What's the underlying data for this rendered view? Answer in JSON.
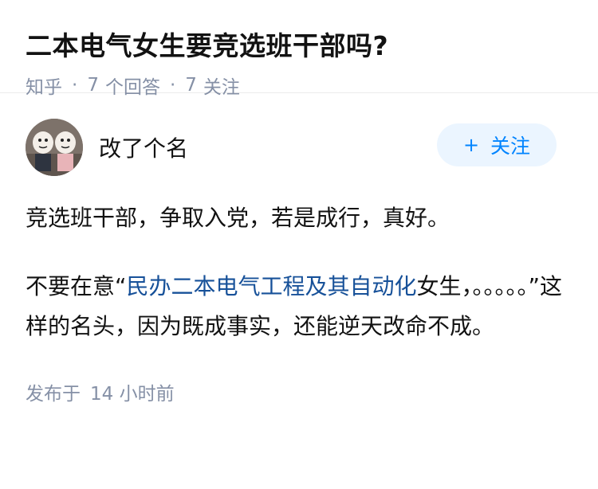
{
  "question": {
    "title": "二本电气女生要竞选班干部吗?",
    "source": "知乎",
    "answer_count": "7",
    "answer_label": "个回答",
    "follow_count": "7",
    "follow_label": "关注"
  },
  "answer": {
    "author_name": "改了个名",
    "follow_button": {
      "plus": "+",
      "label": "关注"
    },
    "paragraph1": "竞选班干部，争取入党，若是成行，真好。",
    "paragraph2_before": "不要在意“",
    "paragraph2_link": "民办二本电气工程及其自动化",
    "paragraph2_after": "女生，。。。。。”这样的名头，因为既成事实，还能逆天改命不成。",
    "publish_label": "发布于",
    "publish_time": "14 小时前"
  },
  "colors": {
    "link": "#175199",
    "meta": "#8590a6",
    "button_bg": "#ebf5ff",
    "button_text": "#0084ff"
  }
}
